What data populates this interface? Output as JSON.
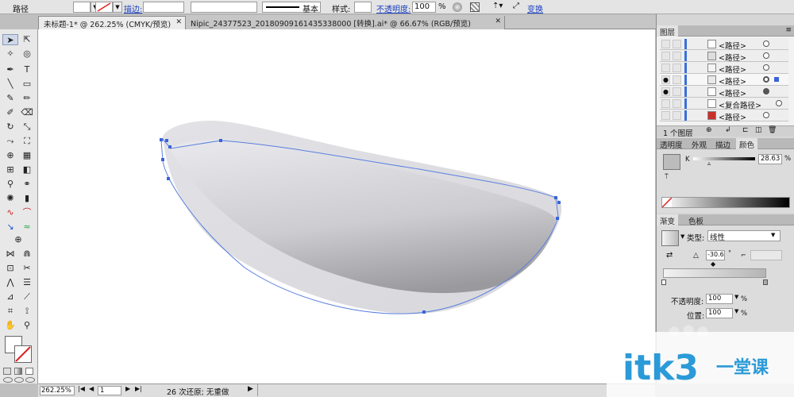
{
  "control_bar": {
    "object_type": "路径",
    "stroke_link": "描边:",
    "stroke_profile": "基本",
    "style_label": "样式:",
    "opacity_link": "不透明度:",
    "opacity_value": "100",
    "opacity_unit": "%",
    "transform_link": "变换"
  },
  "tabs": [
    {
      "label": "未标题-1* @ 262.25% (CMYK/预览)",
      "active": true
    },
    {
      "label": "Nipic_24377523_20180909161435338000 [转换].ai* @ 66.67% (RGB/预览)",
      "active": false
    }
  ],
  "layers_panel": {
    "title": "图层",
    "rows": [
      {
        "name": "<路径>",
        "visible": false
      },
      {
        "name": "<路径>",
        "visible": false
      },
      {
        "name": "<路径>",
        "visible": false
      },
      {
        "name": "<路径>",
        "visible": true
      },
      {
        "name": "<路径>",
        "visible": true
      },
      {
        "name": "<复合路径>",
        "visible": false
      },
      {
        "name": "<路径>",
        "visible": false
      }
    ],
    "footer": "1 个图层"
  },
  "color_panel": {
    "tabs": [
      "透明度",
      "外观",
      "描边",
      "颜色"
    ],
    "channel": "K",
    "value": "28.63",
    "unit": "%"
  },
  "gradient_panel": {
    "tabs": [
      "渐变",
      "色板"
    ],
    "type_label": "类型:",
    "type_value": "线性",
    "angle": "-30.6",
    "angle_unit": "°",
    "opacity_label": "不透明度:",
    "opacity_value": "100",
    "position_label": "位置:",
    "position_value": "100",
    "unit": "%"
  },
  "status_bar": {
    "zoom": "262.25%",
    "page": "1",
    "message": "26 次还原; 无重做"
  },
  "watermark": {
    "text": "itk3",
    "subtext": "一堂课",
    "color": "#2b9ad8"
  }
}
